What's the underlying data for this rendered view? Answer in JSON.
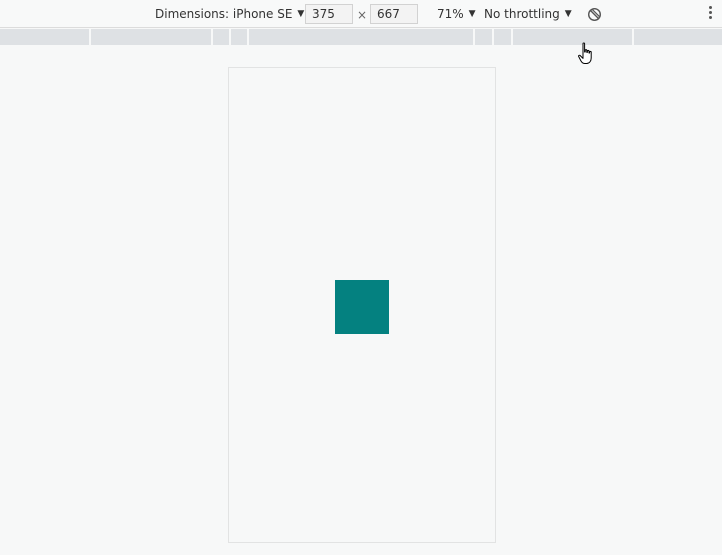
{
  "toolbar": {
    "dimensions_label": "Dimensions: iPhone SE",
    "width_value": "375",
    "height_value": "667",
    "times_symbol": "×",
    "zoom_label": "71%",
    "throttling_label": "No throttling",
    "caret": "▼"
  },
  "icons": {
    "rotate": "rotate-icon",
    "more": "kebab-menu-icon",
    "cursor": "hand-pointer-icon"
  },
  "colors": {
    "square": "#048180",
    "media_bar": "#dee1e4",
    "background": "#f7f8f8"
  }
}
